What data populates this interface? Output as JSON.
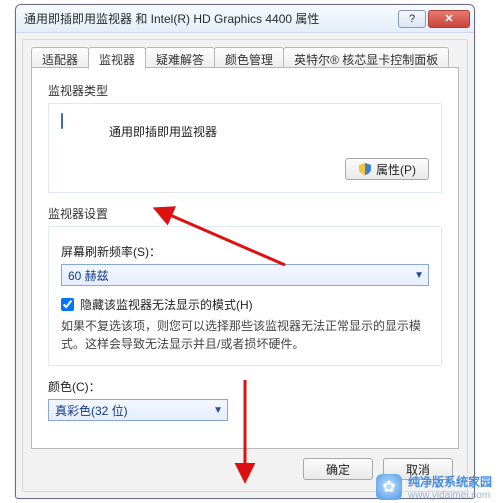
{
  "window": {
    "title": "通用即插即用监视器 和 Intel(R) HD Graphics 4400 属性",
    "close_symbol": "✕",
    "help_symbol": "?"
  },
  "tabs": {
    "items": [
      {
        "label": "适配器"
      },
      {
        "label": "监视器"
      },
      {
        "label": "疑难解答"
      },
      {
        "label": "颜色管理"
      },
      {
        "label": "英特尔® 核芯显卡控制面板"
      }
    ],
    "active_index": 1
  },
  "monitor_type": {
    "section_label": "监视器类型",
    "name": "通用即插即用监视器",
    "properties_button": "属性(P)"
  },
  "monitor_settings": {
    "section_label": "监视器设置",
    "refresh_label": "屏幕刷新频率(S)：",
    "refresh_value": "60 赫兹",
    "hide_modes_checkbox_label": "隐藏该监视器无法显示的模式(H)",
    "hide_modes_checked": true,
    "hide_modes_description": "如果不复选该项，则您可以选择那些该监视器无法正常显示的显示模式。这样会导致无法显示并且/或者损坏硬件。"
  },
  "color": {
    "label": "颜色(C)：",
    "value": "真彩色(32 位)"
  },
  "footer": {
    "ok": "确定",
    "cancel": "取消"
  },
  "watermark": {
    "logo_glyph": "✿",
    "line1": "纯净版系统家园",
    "line2": "www.yidaimei.com"
  }
}
